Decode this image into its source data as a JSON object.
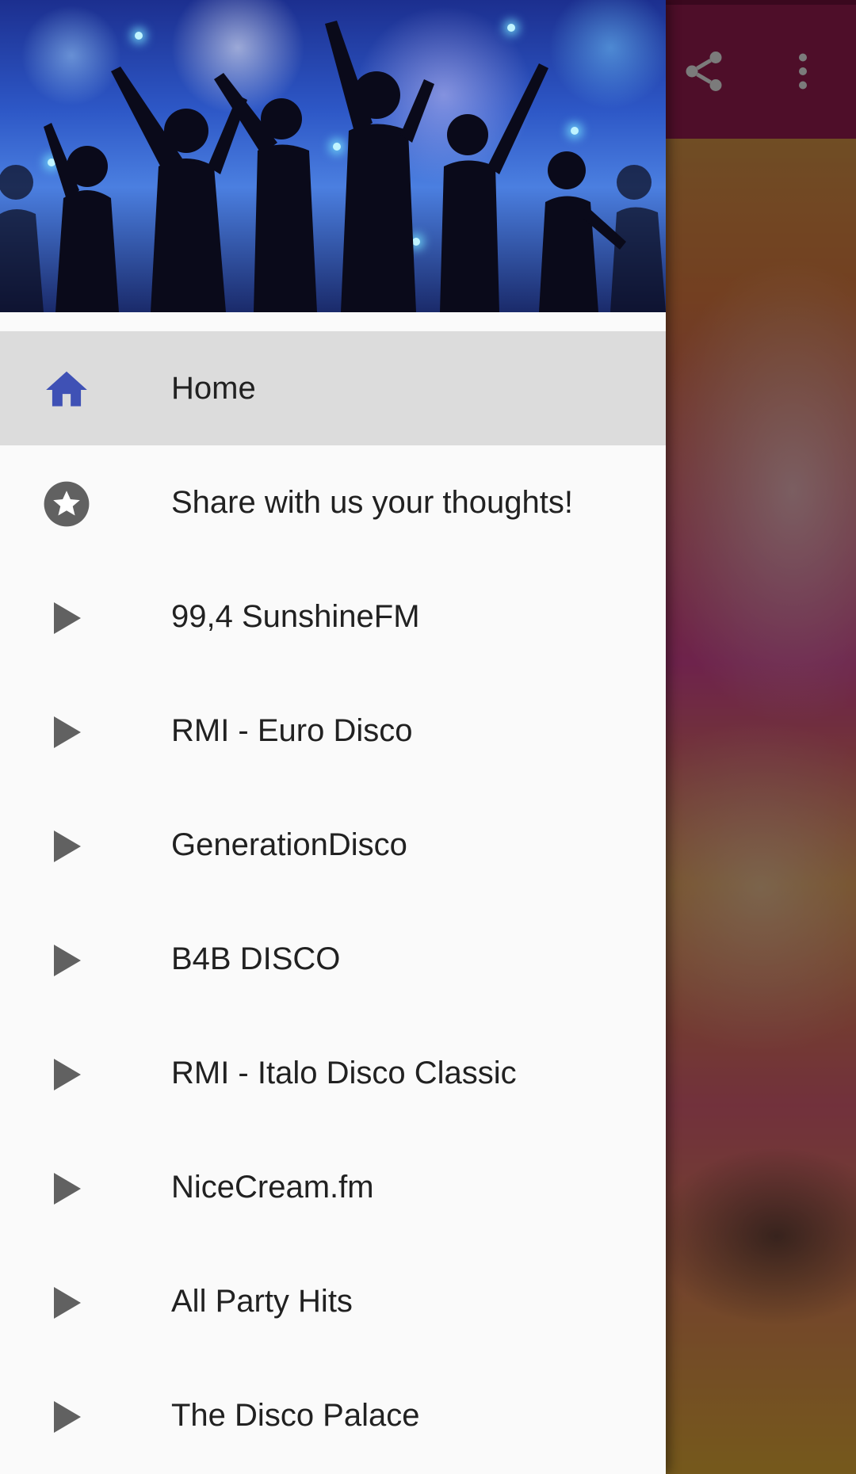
{
  "toolbar": {
    "actions": [
      {
        "icon": "share-icon"
      },
      {
        "icon": "more-vert-icon"
      }
    ]
  },
  "drawer": {
    "header_image": "party-crowd-silhouettes",
    "items": [
      {
        "label": "Home",
        "icon": "home-icon",
        "selected": true
      },
      {
        "label": "Share with us your thoughts!",
        "icon": "star-circle-icon",
        "selected": false
      },
      {
        "label": "99,4 SunshineFM",
        "icon": "play-icon",
        "selected": false
      },
      {
        "label": "RMI - Euro Disco",
        "icon": "play-icon",
        "selected": false
      },
      {
        "label": "GenerationDisco",
        "icon": "play-icon",
        "selected": false
      },
      {
        "label": "B4B DISCO",
        "icon": "play-icon",
        "selected": false
      },
      {
        "label": "RMI - Italo Disco Classic",
        "icon": "play-icon",
        "selected": false
      },
      {
        "label": "NiceCream.fm",
        "icon": "play-icon",
        "selected": false
      },
      {
        "label": "All Party Hits",
        "icon": "play-icon",
        "selected": false
      },
      {
        "label": "The Disco Palace",
        "icon": "play-icon",
        "selected": false
      }
    ]
  },
  "colors": {
    "toolbar": "#8e1b4b",
    "home_icon": "#3f51b5",
    "icon_gray": "#616161",
    "selected_bg": "#dcdcdc",
    "drawer_bg": "#fafafa"
  }
}
